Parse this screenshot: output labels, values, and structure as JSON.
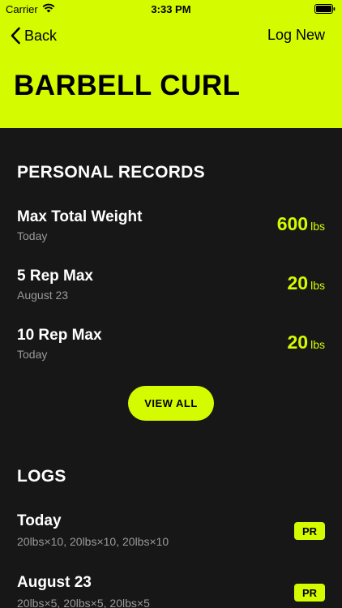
{
  "status_bar": {
    "carrier": "Carrier",
    "time": "3:33 PM"
  },
  "nav": {
    "back_label": "Back",
    "action_label": "Log New"
  },
  "title": "BARBELL CURL",
  "personal_records": {
    "heading": "PERSONAL RECORDS",
    "items": [
      {
        "name": "Max Total Weight",
        "date": "Today",
        "value": "600",
        "unit": "lbs"
      },
      {
        "name": "5 Rep Max",
        "date": "August 23",
        "value": "20",
        "unit": "lbs"
      },
      {
        "name": "10 Rep Max",
        "date": "Today",
        "value": "20",
        "unit": "lbs"
      }
    ],
    "view_all_label": "VIEW ALL"
  },
  "logs": {
    "heading": "LOGS",
    "items": [
      {
        "date": "Today",
        "sets": "20lbs×10, 20lbs×10, 20lbs×10",
        "badge": "PR"
      },
      {
        "date": "August 23",
        "sets": "20lbs×5, 20lbs×5, 20lbs×5",
        "badge": "PR"
      }
    ]
  },
  "colors": {
    "accent": "#d4fb00",
    "background": "#171717",
    "muted_text": "#9a9a9a"
  }
}
